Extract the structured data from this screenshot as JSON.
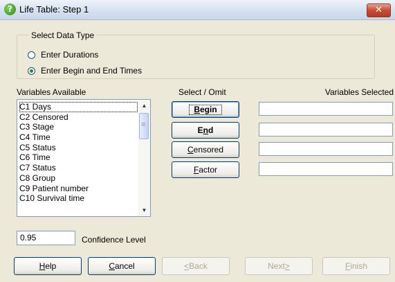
{
  "window": {
    "title": "Life Table: Step 1",
    "close_glyph": "✕",
    "help_glyph": "?"
  },
  "data_type": {
    "legend": "Select Data Type",
    "options": [
      {
        "label": "Enter Durations",
        "checked": false
      },
      {
        "label": "Enter Begin and End Times",
        "checked": true
      }
    ]
  },
  "variables_available": {
    "label": "Variables Available",
    "items": [
      "C1 Days",
      "C2 Censored",
      "C3 Stage",
      "C4 Time",
      "C5 Status",
      "C6 Time",
      "C7 Status",
      "C8 Group",
      "C9 Patient number",
      "C10 Survival time"
    ],
    "scroll_up_glyph": "▲",
    "scroll_down_glyph": "▼"
  },
  "select_omit": {
    "label": "Select / Omit",
    "buttons": [
      {
        "pre": "",
        "key": "B",
        "post": "egin"
      },
      {
        "pre": "E",
        "key": "n",
        "post": "d"
      },
      {
        "pre": "",
        "key": "C",
        "post": "ensored"
      },
      {
        "pre": "",
        "key": "F",
        "post": "actor"
      }
    ]
  },
  "variables_selected": {
    "label": "Variables Selected"
  },
  "confidence": {
    "value": "0.95",
    "label": "Confidence Level"
  },
  "footer": {
    "help": {
      "key": "H",
      "post": "elp"
    },
    "cancel": {
      "key": "C",
      "post": "ancel"
    },
    "back": {
      "key": "<",
      "post": " Back"
    },
    "next": {
      "pre": "Next ",
      "key": ">"
    },
    "finish": {
      "key": "F",
      "post": "inish"
    }
  },
  "colors": {
    "dialog_bg": "#ece9d8",
    "border_blue": "#7f9db9",
    "close_red": "#c84b32"
  }
}
